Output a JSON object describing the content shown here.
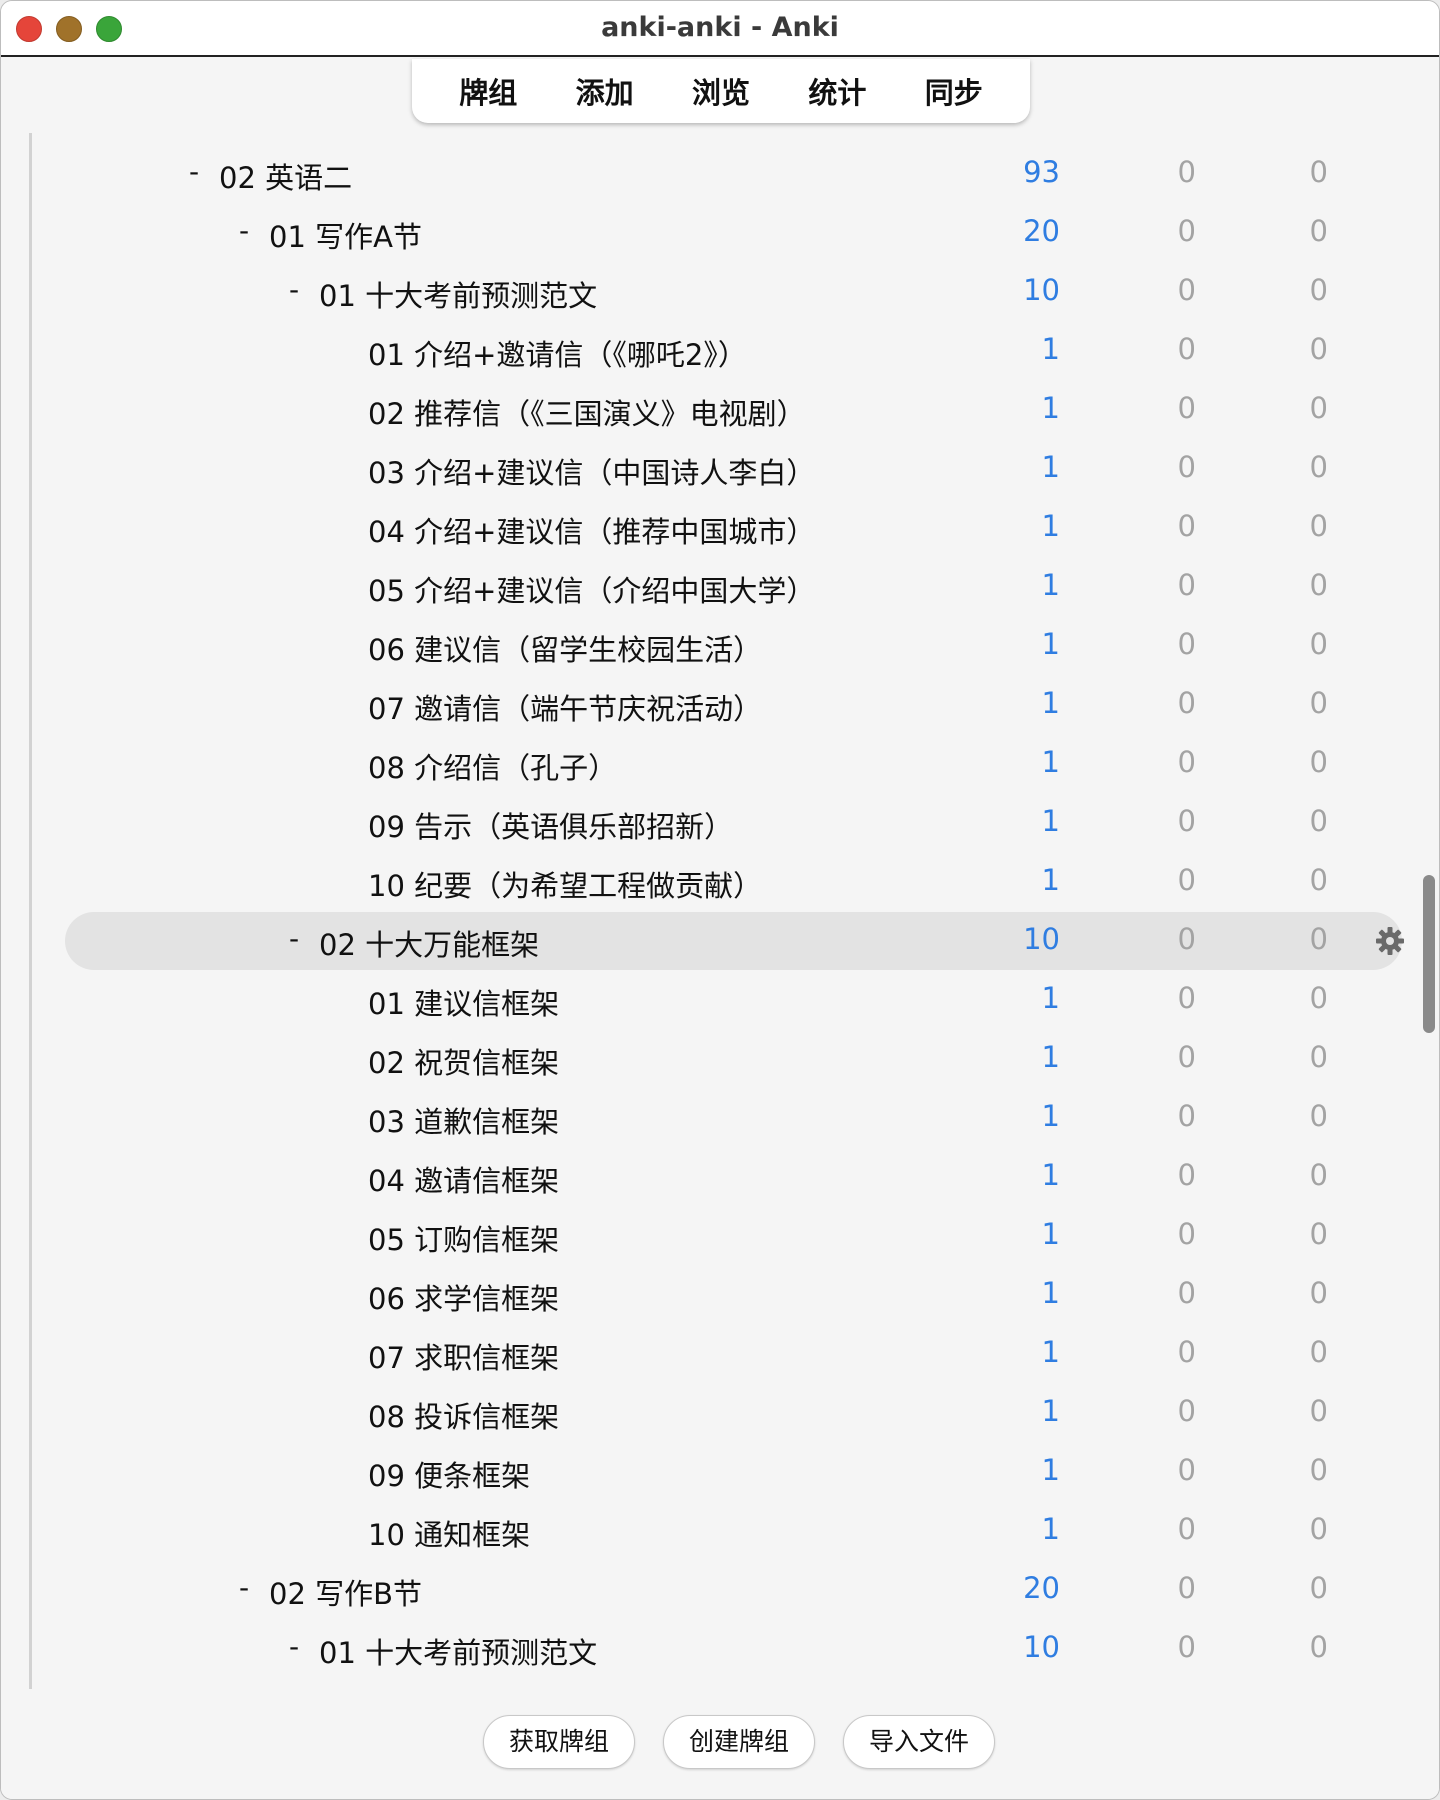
{
  "window": {
    "title": "anki-anki - Anki"
  },
  "toolbar": {
    "tabs": [
      "牌组",
      "添加",
      "浏览",
      "统计",
      "同步"
    ]
  },
  "colors": {
    "due_new": "#2f7de1",
    "zero": "#a3a3a3"
  },
  "decks": [
    {
      "collapse": "-",
      "name": "02 英语二",
      "level": 0,
      "counts": [
        "93",
        "0",
        "0"
      ]
    },
    {
      "collapse": "-",
      "name": "01 写作A节",
      "level": 1,
      "counts": [
        "20",
        "0",
        "0"
      ]
    },
    {
      "collapse": "-",
      "name": "01 十大考前预测范文",
      "level": 2,
      "counts": [
        "10",
        "0",
        "0"
      ]
    },
    {
      "collapse": "",
      "name": "01 介绍+邀请信（《哪吒2》）",
      "level": 3,
      "counts": [
        "1",
        "0",
        "0"
      ]
    },
    {
      "collapse": "",
      "name": "02 推荐信（《三国演义》电视剧）",
      "level": 3,
      "counts": [
        "1",
        "0",
        "0"
      ]
    },
    {
      "collapse": "",
      "name": "03 介绍+建议信（中国诗人李白）",
      "level": 3,
      "counts": [
        "1",
        "0",
        "0"
      ]
    },
    {
      "collapse": "",
      "name": "04 介绍+建议信（推荐中国城市）",
      "level": 3,
      "counts": [
        "1",
        "0",
        "0"
      ]
    },
    {
      "collapse": "",
      "name": "05 介绍+建议信（介绍中国大学）",
      "level": 3,
      "counts": [
        "1",
        "0",
        "0"
      ]
    },
    {
      "collapse": "",
      "name": "06 建议信（留学生校园生活）",
      "level": 3,
      "counts": [
        "1",
        "0",
        "0"
      ]
    },
    {
      "collapse": "",
      "name": "07 邀请信（端午节庆祝活动）",
      "level": 3,
      "counts": [
        "1",
        "0",
        "0"
      ]
    },
    {
      "collapse": "",
      "name": "08 介绍信（孔子）",
      "level": 3,
      "counts": [
        "1",
        "0",
        "0"
      ]
    },
    {
      "collapse": "",
      "name": "09 告示（英语俱乐部招新）",
      "level": 3,
      "counts": [
        "1",
        "0",
        "0"
      ]
    },
    {
      "collapse": "",
      "name": "10 纪要（为希望工程做贡献）",
      "level": 3,
      "counts": [
        "1",
        "0",
        "0"
      ]
    },
    {
      "collapse": "-",
      "name": "02 十大万能框架",
      "level": 2,
      "counts": [
        "10",
        "0",
        "0"
      ],
      "selected": true
    },
    {
      "collapse": "",
      "name": "01 建议信框架",
      "level": 3,
      "counts": [
        "1",
        "0",
        "0"
      ]
    },
    {
      "collapse": "",
      "name": "02 祝贺信框架",
      "level": 3,
      "counts": [
        "1",
        "0",
        "0"
      ]
    },
    {
      "collapse": "",
      "name": "03 道歉信框架",
      "level": 3,
      "counts": [
        "1",
        "0",
        "0"
      ]
    },
    {
      "collapse": "",
      "name": "04 邀请信框架",
      "level": 3,
      "counts": [
        "1",
        "0",
        "0"
      ]
    },
    {
      "collapse": "",
      "name": "05 订购信框架",
      "level": 3,
      "counts": [
        "1",
        "0",
        "0"
      ]
    },
    {
      "collapse": "",
      "name": "06 求学信框架",
      "level": 3,
      "counts": [
        "1",
        "0",
        "0"
      ]
    },
    {
      "collapse": "",
      "name": "07 求职信框架",
      "level": 3,
      "counts": [
        "1",
        "0",
        "0"
      ]
    },
    {
      "collapse": "",
      "name": "08 投诉信框架",
      "level": 3,
      "counts": [
        "1",
        "0",
        "0"
      ]
    },
    {
      "collapse": "",
      "name": "09 便条框架",
      "level": 3,
      "counts": [
        "1",
        "0",
        "0"
      ]
    },
    {
      "collapse": "",
      "name": "10 通知框架",
      "level": 3,
      "counts": [
        "1",
        "0",
        "0"
      ]
    },
    {
      "collapse": "-",
      "name": "02 写作B节",
      "level": 1,
      "counts": [
        "20",
        "0",
        "0"
      ]
    },
    {
      "collapse": "-",
      "name": "01 十大考前预测范文",
      "level": 2,
      "counts": [
        "10",
        "0",
        "0"
      ]
    }
  ],
  "bottom_bar": {
    "get_shared": "获取牌组",
    "create_deck": "创建牌组",
    "import_file": "导入文件"
  }
}
